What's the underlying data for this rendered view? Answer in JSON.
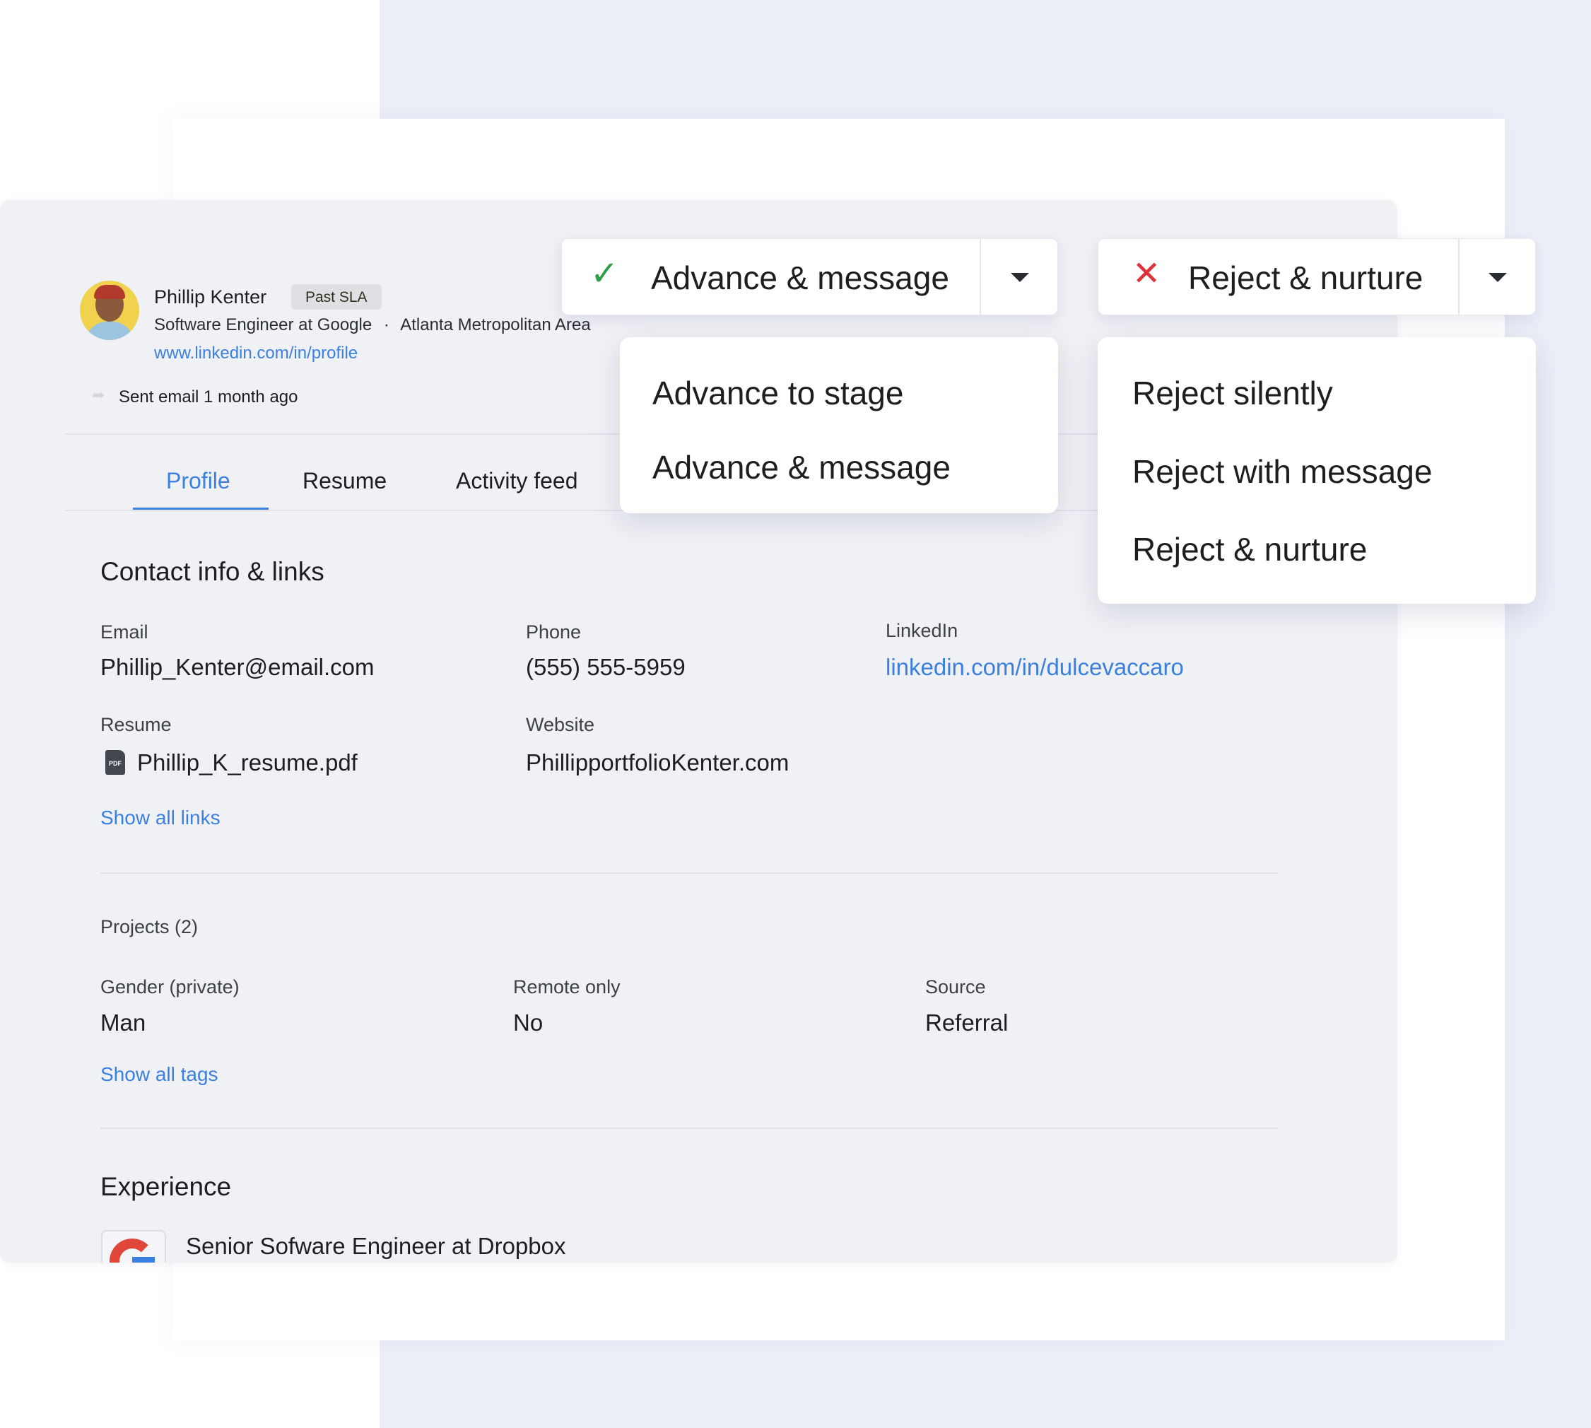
{
  "candidate": {
    "name": "Phillip Kenter",
    "badge": "Past SLA",
    "headline": "Software Engineer at Google",
    "separator": "·",
    "location": "Atlanta Metropolitan Area",
    "profile_link": "www.linkedin.com/in/profile",
    "last_activity": "Sent email 1 month ago"
  },
  "tabs": [
    {
      "label": "Profile",
      "active": true
    },
    {
      "label": "Resume"
    },
    {
      "label": "Activity feed"
    }
  ],
  "contact": {
    "heading": "Contact info & links",
    "email_label": "Email",
    "email": "Phillip_Kenter@email.com",
    "phone_label": "Phone",
    "phone": "(555) 555-5959",
    "linkedin_label": "LinkedIn",
    "linkedin": "linkedin.com/in/dulcevaccaro",
    "resume_label": "Resume",
    "resume_file": "Phillip_K_resume.pdf",
    "resume_icon_text": "PDF",
    "website_label": "Website",
    "website": "PhillipportfolioKenter.com",
    "show_all_links": "Show all links"
  },
  "details": {
    "projects": "Projects (2)",
    "gender_label": "Gender (private)",
    "gender": "Man",
    "remote_label": "Remote only",
    "remote": "No",
    "source_label": "Source",
    "source": "Referral",
    "show_all_tags": "Show all tags"
  },
  "experience": {
    "heading": "Experience",
    "items": [
      {
        "title": "Senior Sofware Engineer at Dropbox"
      }
    ]
  },
  "advance": {
    "label": "Advance & message",
    "menu": [
      "Advance to stage",
      "Advance & message"
    ],
    "color": "#2e9d48"
  },
  "reject": {
    "label": "Reject & nurture",
    "menu": [
      "Reject silently",
      "Reject with message",
      "Reject & nurture"
    ],
    "color": "#e0323a"
  }
}
